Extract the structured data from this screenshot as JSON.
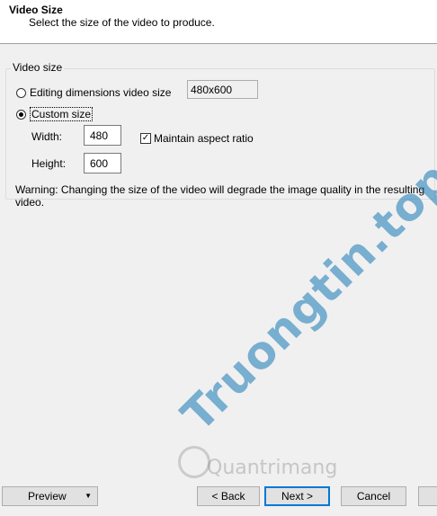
{
  "header": {
    "title": "Video Size",
    "subtitle": "Select the size of the video to produce."
  },
  "group": {
    "legend": "Video size",
    "option_editing": {
      "label": "Editing dimensions video size",
      "checked": false
    },
    "option_custom": {
      "label": "Custom size",
      "checked": true
    },
    "editing_dimensions_value": "480x600",
    "width_label": "Width:",
    "width_value": "480",
    "height_label": "Height:",
    "height_value": "600",
    "maintain_aspect": {
      "label": "Maintain aspect ratio",
      "checked": true
    },
    "warning": "Warning: Changing the size of the video will degrade the image quality in the resulting video."
  },
  "footer": {
    "preview_label": "Preview",
    "back_label": "< Back",
    "next_label": "Next >",
    "cancel_label": "Cancel"
  },
  "watermark": {
    "main": "Truongtin.top",
    "secondary": "Quantrimang"
  },
  "colors": {
    "accent": "#0078d7",
    "watermark_blue": "#1678b4",
    "watermark_red": "#e14650"
  }
}
